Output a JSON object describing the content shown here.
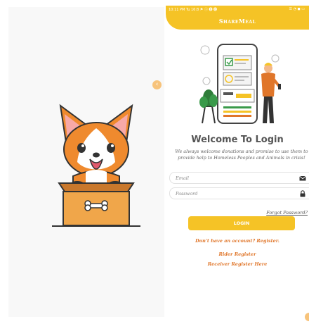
{
  "status_bar": {
    "left": "10:11 PM Tu 16:8 ⚑ ⓢ 🅑 🅑",
    "right": "☰ ◔ ◼ ▭"
  },
  "app": {
    "title": "ShareMeal"
  },
  "login": {
    "heading": "Welcome To Login",
    "tagline": "We always welcome donations and promise to use them to provide help to Homeless Peoples and Animals in crisis!",
    "email_placeholder": "Email",
    "password_placeholder": "Password",
    "forgot_password": "Forgot Password?",
    "login_button": "LOGIN",
    "register_prompt": "Don't have an account? Register.",
    "rider_register": "Rider Register",
    "receiver_register": "Receiver Register Here"
  },
  "icons": {
    "email": "envelope-icon",
    "password": "lock-icon",
    "handle": "drag-handle-icon"
  },
  "colors": {
    "primary": "#f5c326",
    "link": "#e0762a",
    "mascot_orange": "#ef8a2e",
    "box": "#f0a64a"
  }
}
